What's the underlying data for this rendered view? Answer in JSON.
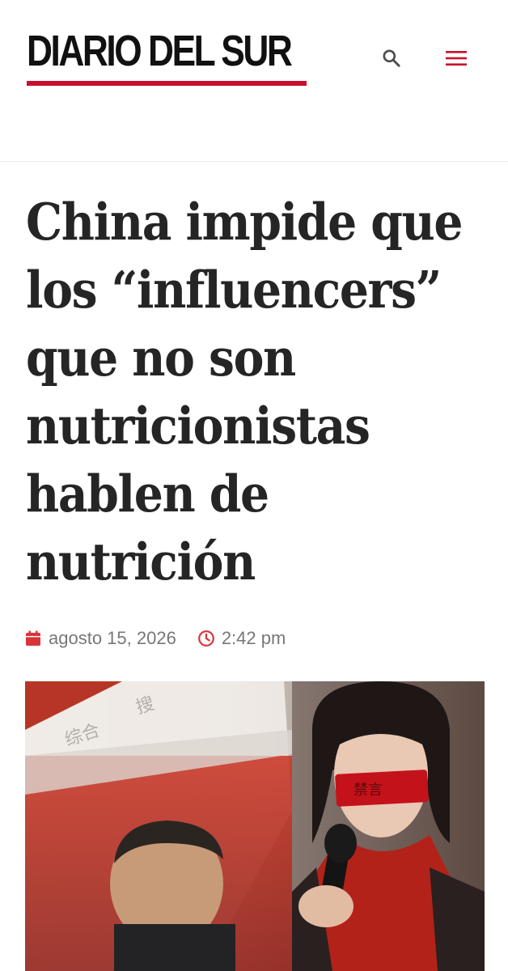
{
  "site": {
    "name": "Diario del Sur",
    "logo_text": "DIARIO DEL SUR",
    "brand_color": "#c8102e"
  },
  "header": {
    "search_icon": "search-icon",
    "menu_icon": "hamburger-menu-icon"
  },
  "article": {
    "title_lines": [
      "China impide que",
      "los “influencers”",
      "que no son",
      "nutricionistas",
      "hablen de",
      "nutrición"
    ],
    "date": "agosto 15, 2026",
    "time": "2:42 pm",
    "date_icon": "calendar-icon",
    "time_icon": "clock-icon",
    "hero_image": {
      "stamp_text": "禁言",
      "blurred_text": [
        "综合",
        "搜"
      ]
    }
  }
}
